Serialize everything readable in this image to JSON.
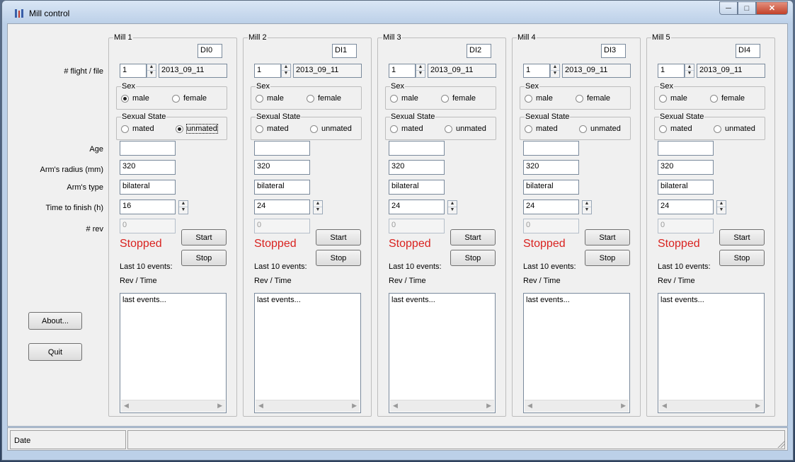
{
  "window": {
    "title": "Mill control"
  },
  "row_labels": {
    "flight_file": "# flight / file",
    "age": "Age",
    "arm_radius": "Arm's radius (mm)",
    "arm_type": "Arm's type",
    "time_to_finish": "Time to finish (h)",
    "rev": "# rev"
  },
  "buttons": {
    "about": "About...",
    "quit": "Quit"
  },
  "common": {
    "sex_label": "Sex",
    "male": "male",
    "female": "female",
    "sexual_state_label": "Sexual State",
    "mated": "mated",
    "unmated": "unmated",
    "start": "Start",
    "stop": "Stop",
    "last_events_label": "Last 10 events:",
    "rev_time_header": "Rev / Time"
  },
  "mills": [
    {
      "name": "Mill 1",
      "di": "DI0",
      "flight": "1",
      "file": "2013_09_11",
      "sex": "male",
      "sexual_state": "unmated",
      "age": "",
      "radius": "320",
      "arm_type": "bilateral",
      "time_to_finish": "16",
      "rev": "0",
      "status": "Stopped",
      "events": "last events..."
    },
    {
      "name": "Mill 2",
      "di": "DI1",
      "flight": "1",
      "file": "2013_09_11",
      "sex": "",
      "sexual_state": "",
      "age": "",
      "radius": "320",
      "arm_type": "bilateral",
      "time_to_finish": "24",
      "rev": "0",
      "status": "Stopped",
      "events": "last events..."
    },
    {
      "name": "Mill 3",
      "di": "DI2",
      "flight": "1",
      "file": "2013_09_11",
      "sex": "",
      "sexual_state": "",
      "age": "",
      "radius": "320",
      "arm_type": "bilateral",
      "time_to_finish": "24",
      "rev": "0",
      "status": "Stopped",
      "events": "last events..."
    },
    {
      "name": "Mill 4",
      "di": "DI3",
      "flight": "1",
      "file": "2013_09_11",
      "sex": "",
      "sexual_state": "",
      "age": "",
      "radius": "320",
      "arm_type": "bilateral",
      "time_to_finish": "24",
      "rev": "0",
      "status": "Stopped",
      "events": "last events..."
    },
    {
      "name": "Mill 5",
      "di": "DI4",
      "flight": "1",
      "file": "2013_09_11",
      "sex": "",
      "sexual_state": "",
      "age": "",
      "radius": "320",
      "arm_type": "bilateral",
      "time_to_finish": "24",
      "rev": "0",
      "status": "Stopped",
      "events": "last events..."
    }
  ],
  "statusbar": {
    "date": "Date"
  },
  "colors": {
    "status_stopped": "#d9221f",
    "window_frame": "#bcd0e8",
    "close_button": "#c24129"
  }
}
